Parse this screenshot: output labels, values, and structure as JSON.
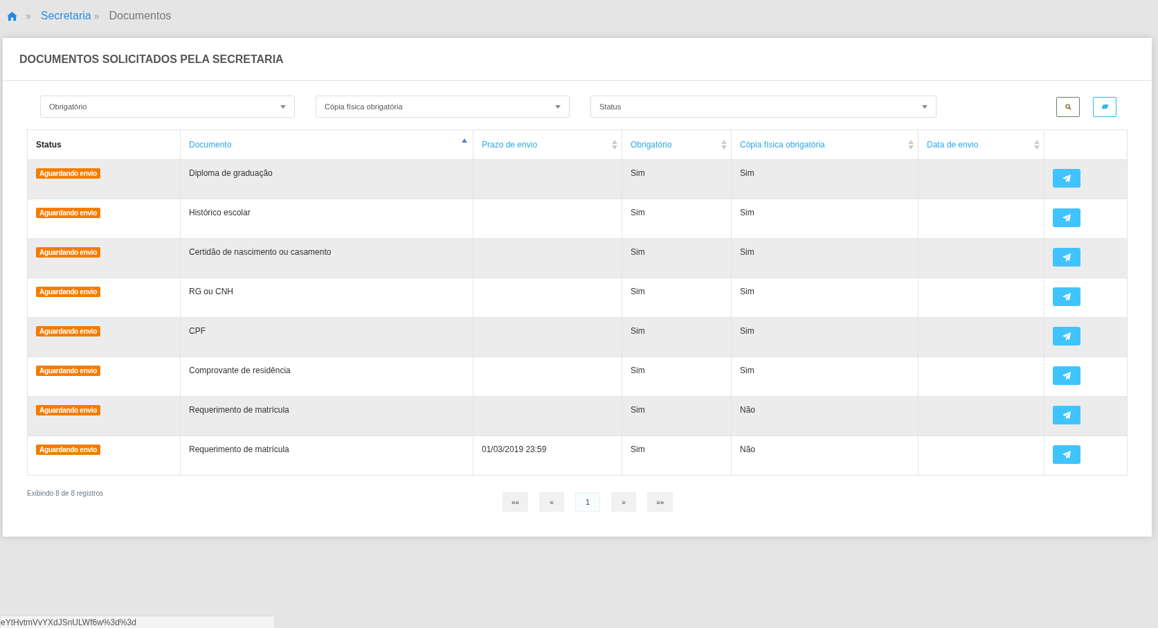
{
  "breadcrumb": {
    "items": [
      {
        "label": "Secretaria",
        "kind": "link"
      },
      {
        "label": "Documentos",
        "kind": "current"
      }
    ],
    "separator": "»"
  },
  "panel": {
    "title": "DOCUMENTOS SOLICITADOS PELA SECRETARIA"
  },
  "filters": [
    {
      "placeholder": "Obrigatório"
    },
    {
      "placeholder": "Cópia física obrigatória"
    },
    {
      "placeholder": "Status"
    }
  ],
  "table": {
    "columns": [
      {
        "label": "Status",
        "sortable": false
      },
      {
        "label": "Documento",
        "sortable": true,
        "sorted": true
      },
      {
        "label": "Prazo de envio",
        "sortable": true,
        "sorted": false
      },
      {
        "label": "Obrigatório",
        "sortable": true,
        "sorted": false
      },
      {
        "label": "Cópia física obrigatória",
        "sortable": true,
        "sorted": false
      },
      {
        "label": "Data de envio",
        "sortable": true,
        "sorted": false
      }
    ],
    "rows": [
      {
        "status": "Aguardando envio",
        "documento": "Diploma de graduação",
        "prazo": "",
        "obrigatorio": "Sim",
        "copia": "Sim",
        "data": ""
      },
      {
        "status": "Aguardando envio",
        "documento": "Histórico escolar",
        "prazo": "",
        "obrigatorio": "Sim",
        "copia": "Sim",
        "data": ""
      },
      {
        "status": "Aguardando envio",
        "documento": "Certidão de nascimento ou casamento",
        "prazo": "",
        "obrigatorio": "Sim",
        "copia": "Sim",
        "data": ""
      },
      {
        "status": "Aguardando envio",
        "documento": "RG ou CNH",
        "prazo": "",
        "obrigatorio": "Sim",
        "copia": "Sim",
        "data": ""
      },
      {
        "status": "Aguardando envio",
        "documento": "CPF",
        "prazo": "",
        "obrigatorio": "Sim",
        "copia": "Sim",
        "data": ""
      },
      {
        "status": "Aguardando envio",
        "documento": "Comprovante de residência",
        "prazo": "",
        "obrigatorio": "Sim",
        "copia": "Sim",
        "data": ""
      },
      {
        "status": "Aguardando envio",
        "documento": "Requerimento de matrícula",
        "prazo": "",
        "obrigatorio": "Sim",
        "copia": "Não",
        "data": ""
      },
      {
        "status": "Aguardando envio",
        "documento": "Requerimento de matrícula",
        "prazo": "01/03/2019 23:59",
        "obrigatorio": "Sim",
        "copia": "Não",
        "data": ""
      }
    ]
  },
  "records_info": "Exibindo 8 de 8 registros",
  "pagination": [
    {
      "label": "««",
      "selected": false
    },
    {
      "label": "«",
      "selected": false
    },
    {
      "label": "1",
      "selected": true
    },
    {
      "label": "»",
      "selected": false
    },
    {
      "label": "»»",
      "selected": false
    }
  ],
  "status_bar": {
    "url": "eYtHvtmVvYXdJSnULWf6w%3d%3d"
  }
}
